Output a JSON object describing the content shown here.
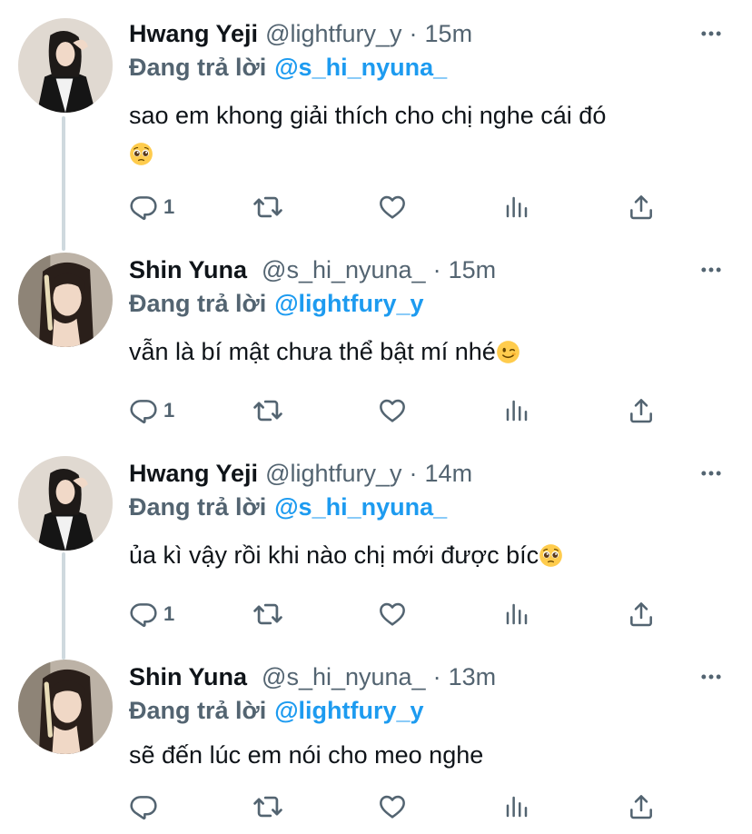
{
  "icons": {
    "reply": "reply-icon",
    "retweet": "retweet-icon",
    "like": "heart-icon",
    "analytics": "analytics-icon",
    "share": "share-icon",
    "more": "more-icon"
  },
  "colors": {
    "accent": "#1d9bf0",
    "muted": "#536471",
    "thread_line": "#cfd9de"
  },
  "tweets": [
    {
      "name": "Hwang Yeji",
      "handle": "@lightfury_y",
      "dot": "·",
      "time": "15m",
      "reply_prefix": "Đang trả lời",
      "mention": "@s_hi_nyuna_",
      "text_line1": "sao em khong giải thích cho chị nghe cái đó",
      "text_line2": "",
      "emoji": "pleading-face",
      "reply_count": "1"
    },
    {
      "name": "Shin Yuna",
      "handle": "@s_hi_nyuna_",
      "dot": "·",
      "time": "15m",
      "reply_prefix": "Đang trả lời",
      "mention": "@lightfury_y",
      "text_line1": "vẫn là bí mật chưa thể bật mí nhé",
      "emoji": "winking-face",
      "reply_count": "1"
    },
    {
      "name": "Hwang Yeji",
      "handle": "@lightfury_y",
      "dot": "·",
      "time": "14m",
      "reply_prefix": "Đang trả lời",
      "mention": "@s_hi_nyuna_",
      "text_line1": "ủa kì vậy rồi khi nào chị mới được bíc",
      "emoji": "pleading-face",
      "reply_count": "1"
    },
    {
      "name": "Shin Yuna",
      "handle": "@s_hi_nyuna_",
      "dot": "·",
      "time": "13m",
      "reply_prefix": "Đang trả lời",
      "mention": "@lightfury_y",
      "text_line1": "sẽ đến lúc em nói cho meo nghe",
      "reply_count": ""
    }
  ]
}
